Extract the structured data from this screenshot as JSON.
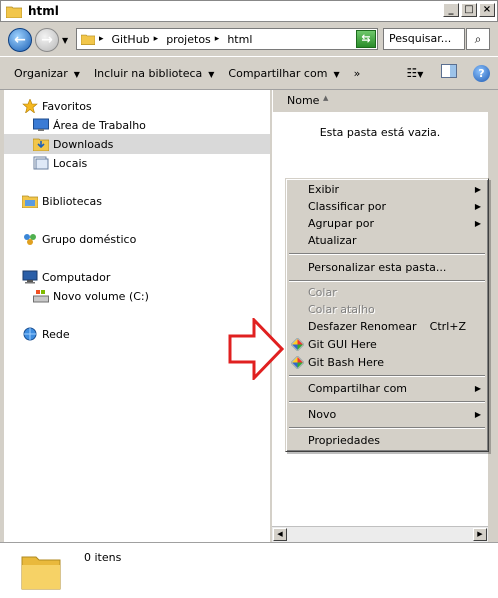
{
  "window": {
    "title": "html"
  },
  "address": {
    "crumbs": [
      "GitHub",
      "projetos",
      "html"
    ],
    "search_placeholder": "Pesquisar..."
  },
  "toolbar": {
    "organize": "Organizar",
    "include_library": "Incluir na biblioteca",
    "share_with": "Compartilhar com",
    "more": "»"
  },
  "nav": {
    "favorites": "Favoritos",
    "desktop": "Área de Trabalho",
    "downloads": "Downloads",
    "places": "Locais",
    "libraries": "Bibliotecas",
    "homegroup": "Grupo doméstico",
    "computer": "Computador",
    "volume": "Novo volume (C:)",
    "network": "Rede"
  },
  "file_list": {
    "column_name": "Nome",
    "empty_message": "Esta pasta está vazia."
  },
  "status": {
    "item_count": "0 itens"
  },
  "context_menu": {
    "view": "Exibir",
    "sort_by": "Classificar por",
    "group_by": "Agrupar por",
    "refresh": "Atualizar",
    "customize": "Personalizar esta pasta...",
    "paste": "Colar",
    "paste_shortcut": "Colar atalho",
    "undo_rename": "Desfazer Renomear",
    "undo_shortcut": "Ctrl+Z",
    "git_gui": "Git GUI Here",
    "git_bash": "Git Bash Here",
    "share_with": "Compartilhar com",
    "new": "Novo",
    "properties": "Propriedades"
  },
  "colors": {
    "annotation_arrow": "#e02020",
    "selection": "#d9d9d9",
    "chrome": "#d4d0c8"
  }
}
